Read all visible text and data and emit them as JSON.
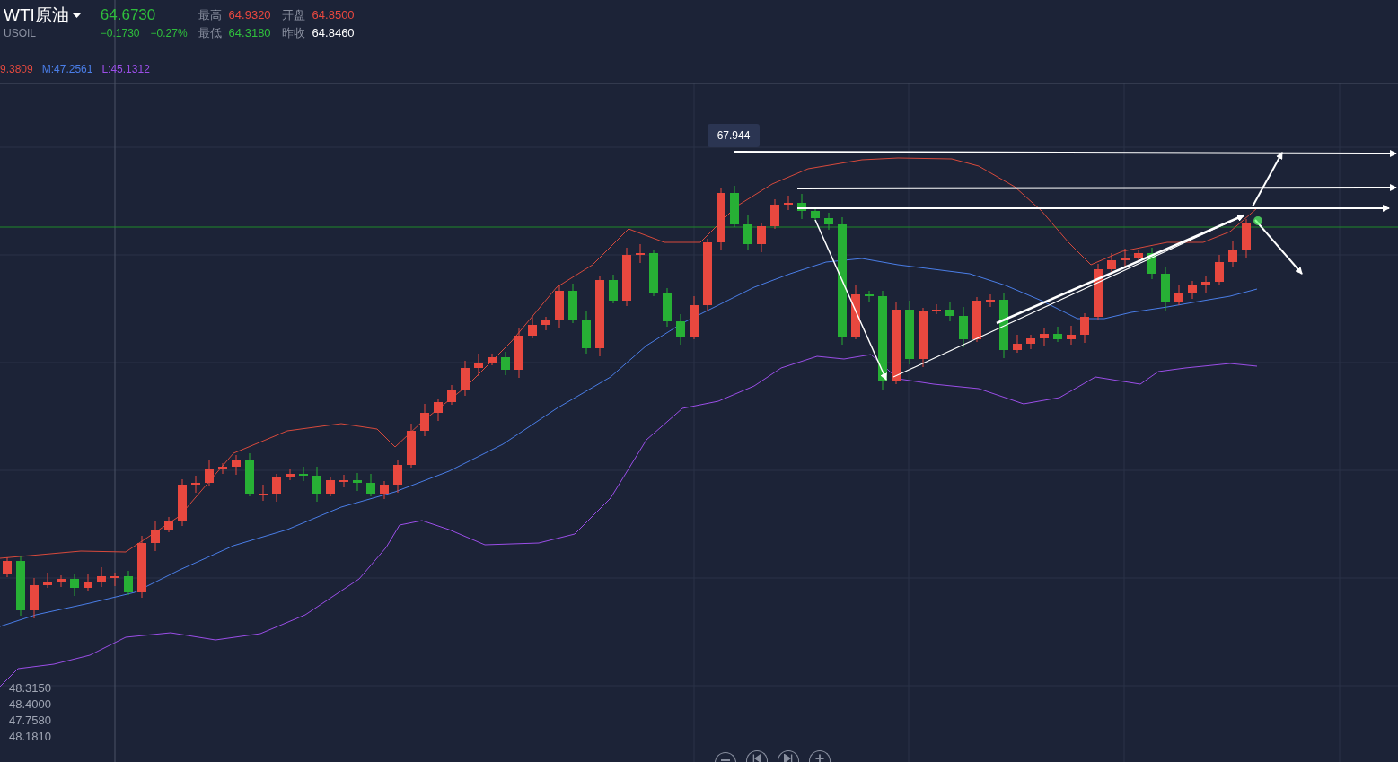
{
  "instrument": {
    "name": "WTI原油",
    "symbol": "USOIL",
    "price": "64.6730",
    "change": "−0.1730",
    "change_pct": "−0.27%"
  },
  "stats": [
    {
      "label": "最高",
      "value": "64.9320",
      "color": "#e8483f"
    },
    {
      "label": "开盘",
      "value": "64.8500",
      "color": "#e8483f"
    },
    {
      "label": "最低",
      "value": "64.3180",
      "color": "#2fbf3c"
    },
    {
      "label": "昨收",
      "value": "64.8460",
      "color": "#ffffff"
    }
  ],
  "indicators": [
    {
      "text": "9.3809",
      "color": "#e0493f"
    },
    {
      "text": "M:47.2561",
      "color": "#4a7ee8"
    },
    {
      "text": "L:45.1312",
      "color": "#9b4ee8"
    }
  ],
  "tooltip": "67.944",
  "ohlc": [
    "48.3150",
    "48.4000",
    "47.7580",
    "48.1810"
  ],
  "controls": [
    {
      "kind": "zoom-out"
    },
    {
      "kind": "back"
    },
    {
      "kind": "forward"
    },
    {
      "kind": "zoom-in"
    }
  ]
}
